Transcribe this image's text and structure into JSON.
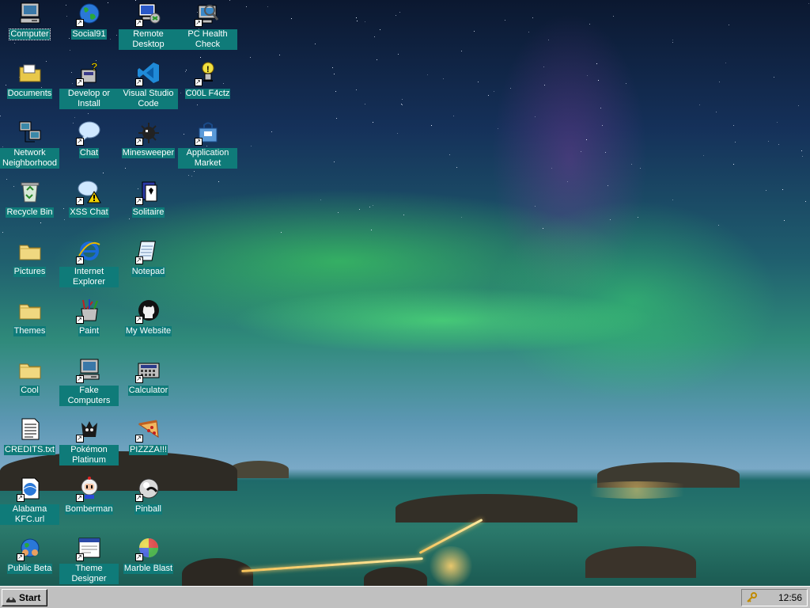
{
  "desktop": {
    "icons": [
      {
        "label": "Computer",
        "icon": "computer-icon",
        "selected": true
      },
      {
        "label": "Social91",
        "icon": "globe-icon"
      },
      {
        "label": "Remote Desktop",
        "icon": "remote-desktop-icon"
      },
      {
        "label": "PC Health Check",
        "icon": "health-check-icon"
      },
      {
        "label": "Documents",
        "icon": "documents-folder-icon"
      },
      {
        "label": "Develop or Install",
        "icon": "develop-install-icon"
      },
      {
        "label": "Visual Studio Code",
        "icon": "vscode-icon"
      },
      {
        "label": "C00L F4ctz",
        "icon": "cool-facts-icon"
      },
      {
        "label": "Network Neighborhood",
        "icon": "network-icon"
      },
      {
        "label": "Chat",
        "icon": "chat-bubble-icon"
      },
      {
        "label": "Minesweeper",
        "icon": "mine-icon"
      },
      {
        "label": "Application Market",
        "icon": "shopping-bag-icon"
      },
      {
        "label": "Recycle Bin",
        "icon": "recycle-bin-icon"
      },
      {
        "label": "XSS Chat",
        "icon": "chat-warning-icon"
      },
      {
        "label": "Solitaire",
        "icon": "cards-icon"
      },
      {
        "label": "Pictures",
        "icon": "folder-icon"
      },
      {
        "label": "Internet Explorer",
        "icon": "internet-explorer-icon"
      },
      {
        "label": "Notepad",
        "icon": "notepad-icon"
      },
      {
        "label": "Themes",
        "icon": "folder-icon"
      },
      {
        "label": "Paint",
        "icon": "paint-icon"
      },
      {
        "label": "My Website",
        "icon": "github-icon"
      },
      {
        "label": "Cool",
        "icon": "folder-icon"
      },
      {
        "label": "Fake Computers",
        "icon": "computer-icon"
      },
      {
        "label": "Calculator",
        "icon": "calculator-icon"
      },
      {
        "label": "CREDITS.txt",
        "icon": "text-file-icon"
      },
      {
        "label": "Pokémon Platinum",
        "icon": "pokemon-icon"
      },
      {
        "label": "PIZZZA!!!",
        "icon": "pizza-icon"
      },
      {
        "label": "Alabama KFC.url",
        "icon": "internet-shortcut-icon"
      },
      {
        "label": "Bomberman",
        "icon": "bomberman-icon"
      },
      {
        "label": "Pinball",
        "icon": "pinball-icon"
      },
      {
        "label": "Public Beta",
        "icon": "globe-people-icon"
      },
      {
        "label": "Theme Designer",
        "icon": "window-icon"
      },
      {
        "label": "Marble Blast",
        "icon": "marble-icon"
      }
    ]
  },
  "taskbar": {
    "start_label": "Start",
    "clock": "12:56",
    "tray_icon": "key-icon"
  },
  "colors": {
    "label_bg": "#0f7b79",
    "taskbar": "#c0c0c0"
  }
}
